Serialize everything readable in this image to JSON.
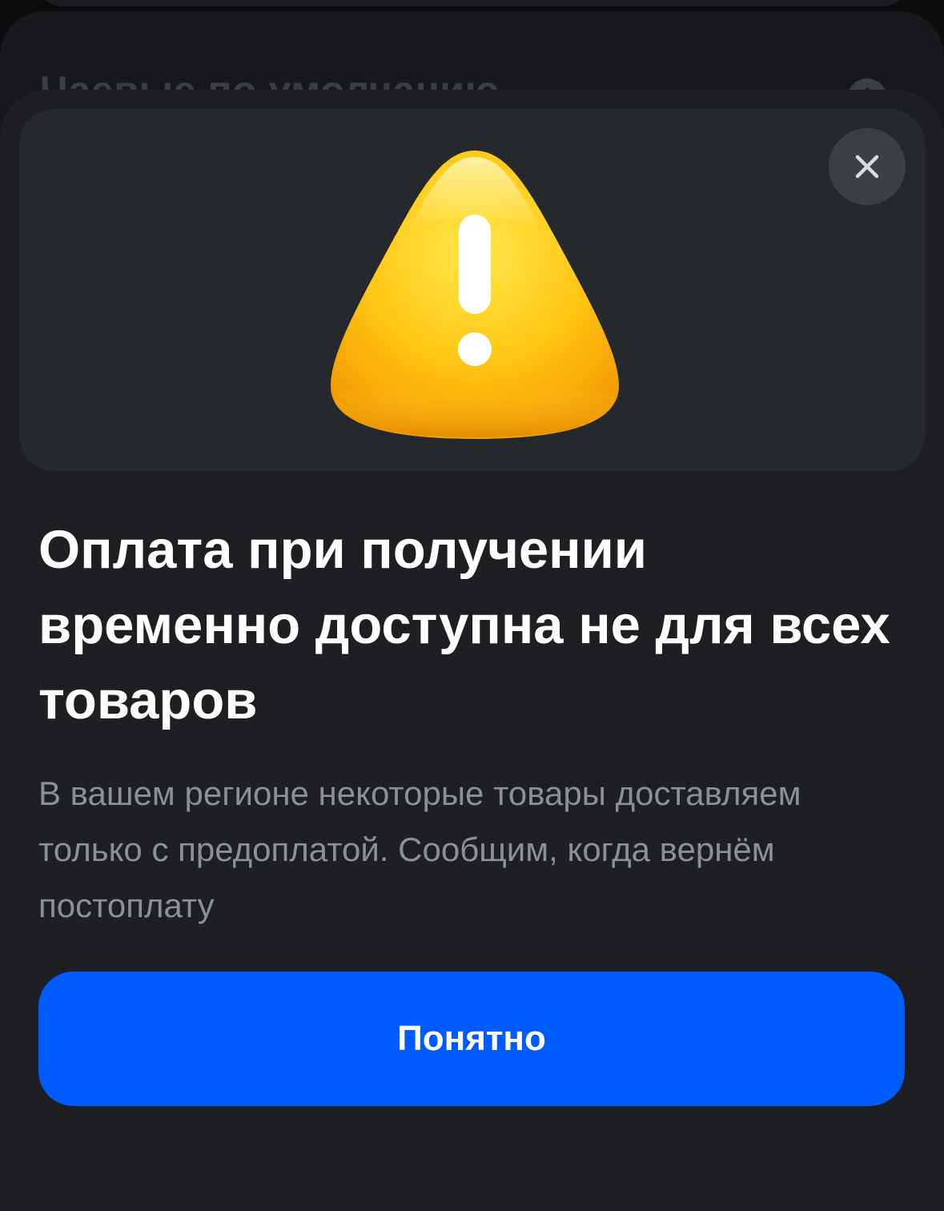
{
  "background": {
    "card_title": "Чаевые по умолчанию",
    "info_icon": "info-icon",
    "info_glyph": "i"
  },
  "modal": {
    "illustration_icon": "warning-triangle-icon",
    "close_icon": "close-icon",
    "title": "Оплата при получении временно доступна не для всех товаров",
    "description": "В вашем регионе некоторые товары доставляем только с предоплатой. Сообщим, когда вернём постоплату",
    "primary_button_label": "Понятно"
  },
  "colors": {
    "accent": "#005bff",
    "warning": "#ffc20e",
    "sheet_background": "#1d1f23",
    "text_primary": "#ffffff",
    "text_secondary": "#8b8f96"
  }
}
